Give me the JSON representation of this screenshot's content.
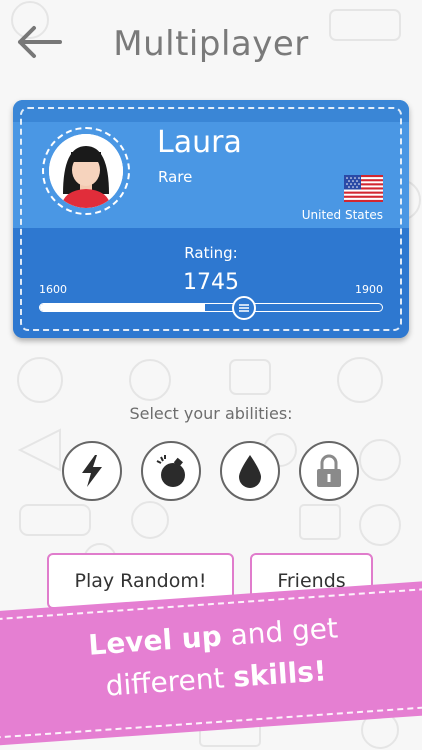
{
  "header": {
    "title": "Multiplayer"
  },
  "profile": {
    "name": "Laura",
    "rank": "Rare",
    "country": "United States",
    "rating_label": "Rating:",
    "rating": "1745",
    "min": "1600",
    "max": "1900",
    "slider_fraction": 0.48
  },
  "abilities": {
    "label": "Select your abilities:",
    "items": [
      "lightning-icon",
      "bomb-icon",
      "drop-icon",
      "lock-icon"
    ]
  },
  "buttons": {
    "play_random": "Play Random!",
    "friends": "Friends"
  },
  "banner": {
    "part1": "Level up",
    "part2": " and get",
    "part3": "different ",
    "part4": "skills!"
  },
  "colors": {
    "card_blue": "#3c8bdc",
    "banner_pink": "#e57fd2",
    "button_border": "#e07ccc"
  }
}
